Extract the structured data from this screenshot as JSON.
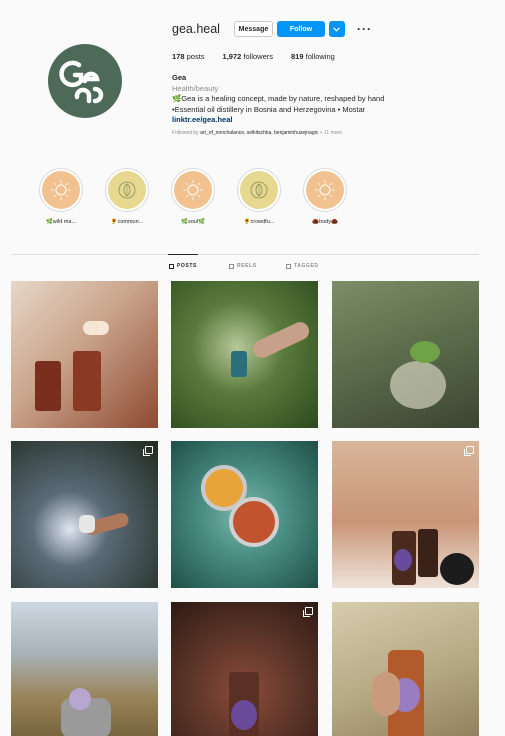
{
  "profile": {
    "username": "gea.heal",
    "avatar_color": "#4d6a58",
    "buttons": {
      "message": "Message",
      "follow": "Follow"
    },
    "stats": [
      {
        "count": "178",
        "label": "posts"
      },
      {
        "count": "1,972",
        "label": "followers"
      },
      {
        "count": "819",
        "label": "following"
      }
    ],
    "bio": {
      "name": "Gea",
      "category": "Health/beauty",
      "line1": "🌿Gea is a healing concept, made by nature, reshaped by hand",
      "line2": "•Essential oil distillery in Bosnia and Herzegovina • Mostar",
      "link": "linktr.ee/gea.heal",
      "followed_prefix": "Followed by",
      "followed_names": "art_of_nonchalance, selkitschka, benjaminhusejnagic",
      "followed_more": "+ 11 more"
    }
  },
  "highlights": [
    {
      "label": "🌿wild ma...",
      "style": "peach"
    },
    {
      "label": "🌻commun...",
      "style": "sage"
    },
    {
      "label": "🌿soul🌿",
      "style": "peach"
    },
    {
      "label": "🌻crowdfu...",
      "style": "sage"
    },
    {
      "label": "🌰body🌰",
      "style": "peach"
    }
  ],
  "tabs": {
    "posts": "POSTS",
    "reels": "REELS",
    "tagged": "TAGGED"
  },
  "colors": {
    "accent": "#0095f6",
    "link": "#00376b"
  }
}
